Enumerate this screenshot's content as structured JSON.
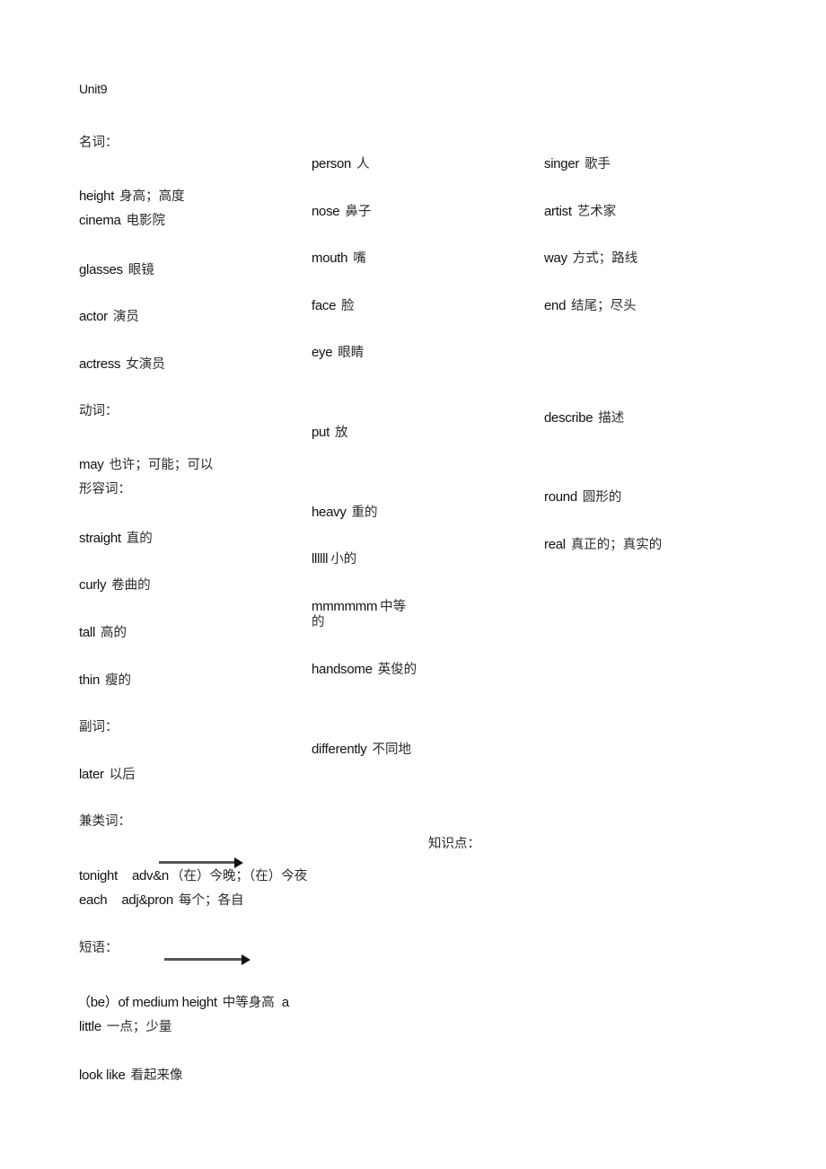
{
  "title": "Unit9",
  "sections": {
    "nouns": {
      "heading": "名词：",
      "col1": [
        {
          "en": "height",
          "zh": "身高；高度"
        },
        {
          "en": "cinema",
          "zh": "电影院"
        },
        {
          "en": "glasses",
          "zh": "眼镜"
        },
        {
          "en": "actor",
          "zh": "演员"
        },
        {
          "en": "actress",
          "zh": "女演员"
        }
      ],
      "col2": [
        {
          "en": "person",
          "zh": "人"
        },
        {
          "en": "nose",
          "zh": "鼻子"
        },
        {
          "en": "mouth",
          "zh": "嘴"
        },
        {
          "en": "face",
          "zh": "脸"
        },
        {
          "en": "eye",
          "zh": "眼睛"
        }
      ],
      "col3": [
        {
          "en": "singer",
          "zh": "歌手"
        },
        {
          "en": "artist",
          "zh": "艺术家"
        },
        {
          "en": "way",
          "zh": "方式；路线"
        },
        {
          "en": "end",
          "zh": "结尾；尽头"
        }
      ]
    },
    "verbs": {
      "heading": "动词：",
      "col1": [
        {
          "en": "may",
          "zh": "也许；可能；可以"
        }
      ],
      "col2": [
        {
          "en": "put",
          "zh": "放"
        }
      ],
      "col3": [
        {
          "en": "describe",
          "zh": "描述"
        }
      ]
    },
    "adjectives": {
      "heading": "形容词：",
      "col1": [
        {
          "en": "straight",
          "zh": "直的"
        },
        {
          "en": "curly",
          "zh": "卷曲的"
        },
        {
          "en": "tall",
          "zh": "高的"
        },
        {
          "en": "thin",
          "zh": "瘦的"
        }
      ],
      "col2": [
        {
          "en": "heavy",
          "zh": "重的"
        },
        {
          "en": "llllll",
          "zh": "小的"
        },
        {
          "en": "mmmmmm",
          "zh": "中等",
          "zh_cont": "的"
        },
        {
          "en": "handsome",
          "zh": "英俊的"
        }
      ],
      "col3": [
        {
          "en": "round",
          "zh": "圆形的"
        },
        {
          "en": "real",
          "zh": "真正的；真实的"
        }
      ]
    },
    "adverbs": {
      "heading": "副词：",
      "col1": [
        {
          "en": "later",
          "zh": "以后"
        }
      ],
      "col2": [
        {
          "en": "differently",
          "zh": "不同地"
        }
      ]
    },
    "multi_class": {
      "heading": "兼类词：",
      "items": [
        {
          "en": "tonight",
          "pos": "adv&n",
          "zh": "（在）今晚；（在）今夜"
        },
        {
          "en": "each",
          "pos": "adj&pron",
          "zh": "每个；各自"
        }
      ]
    },
    "knowledge": {
      "heading": "知识点："
    },
    "phrases": {
      "heading": "短语：",
      "items": [
        {
          "en": "（be）of medium height",
          "zh": "中等身高",
          "tail": "a"
        },
        {
          "en": "little",
          "zh": "一点；少量"
        },
        {
          "en": "look like",
          "zh": "看起来像"
        }
      ]
    }
  },
  "icons": [
    "arrow-right-icon",
    "arrow-right-icon"
  ]
}
